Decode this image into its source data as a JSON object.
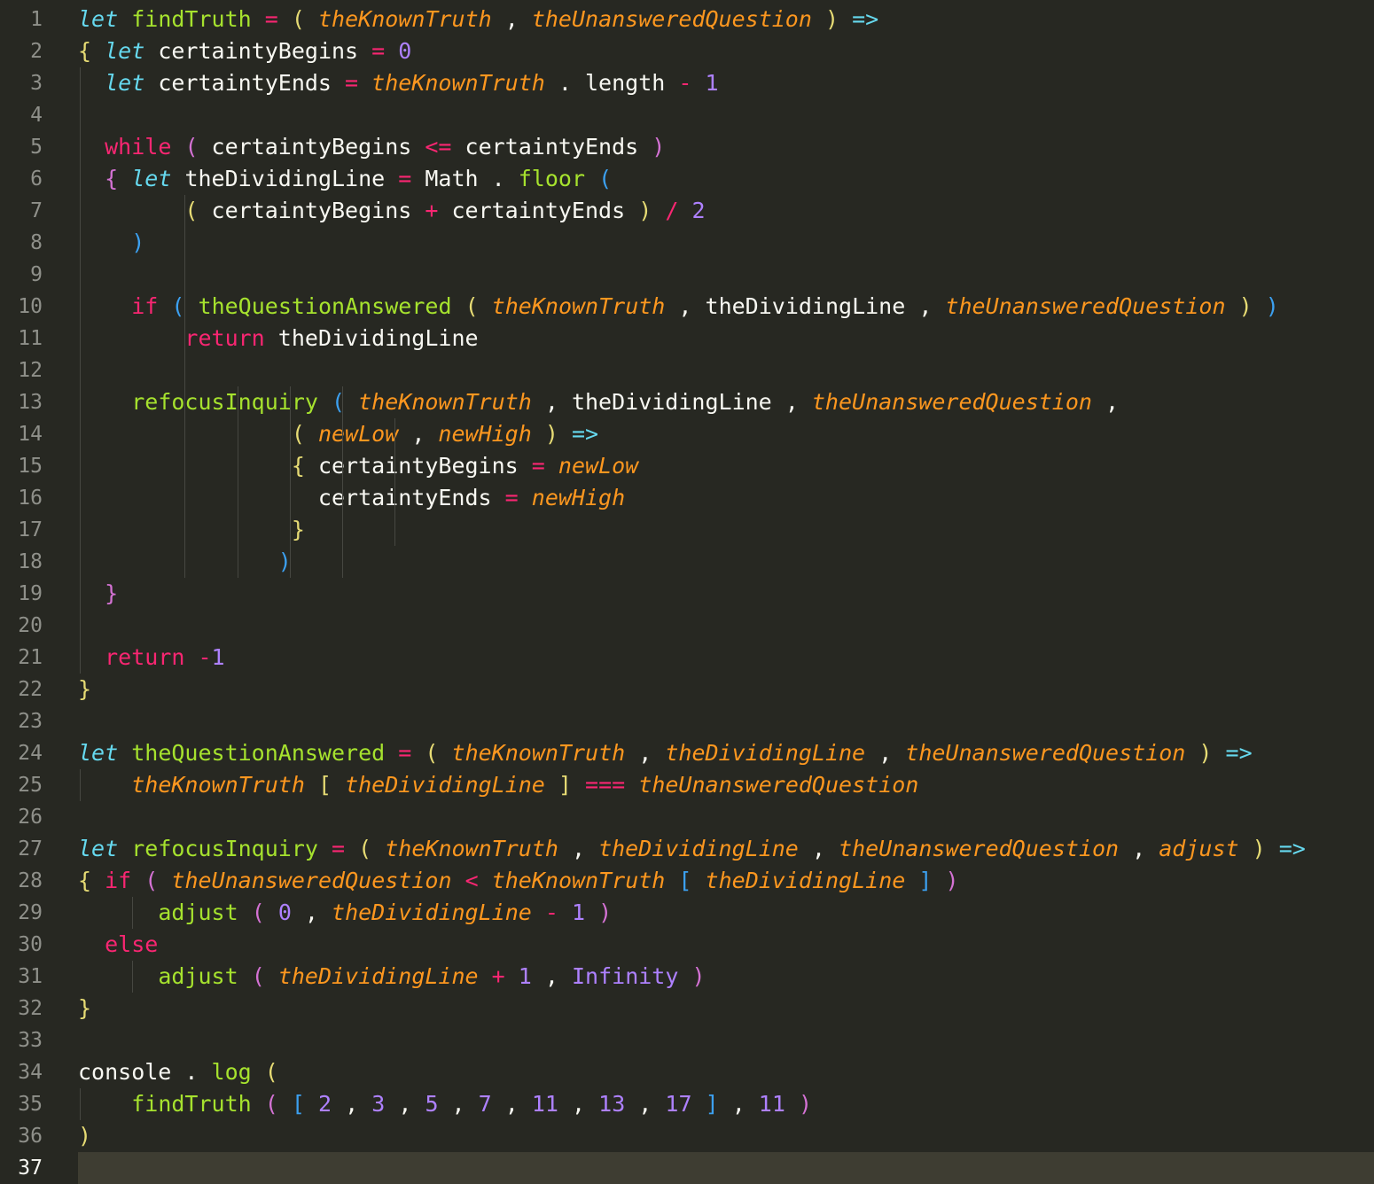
{
  "editor": {
    "theme_colors": {
      "background": "#272822",
      "keyword_let": "#66d9ef",
      "keyword": "#f92672",
      "function": "#a6e22e",
      "parameter": "#fd971f",
      "number": "#ae81ff",
      "bracket_yellow": "#e6db74",
      "bracket_pink": "#d472d4",
      "bracket_blue": "#3ca0f0"
    },
    "active_line": 37,
    "lines": [
      [
        [
          "kw-let",
          "let"
        ],
        [
          "plain",
          " "
        ],
        [
          "fn",
          "findTruth"
        ],
        [
          "plain",
          " "
        ],
        [
          "op",
          "="
        ],
        [
          "plain",
          " "
        ],
        [
          "br-y",
          "("
        ],
        [
          "plain",
          " "
        ],
        [
          "param",
          "theKnownTruth"
        ],
        [
          "plain",
          " , "
        ],
        [
          "param",
          "theUnansweredQuestion"
        ],
        [
          "plain",
          " "
        ],
        [
          "br-y",
          ")"
        ],
        [
          "plain",
          " "
        ],
        [
          "arrow",
          "=>"
        ]
      ],
      [
        [
          "br-y",
          "{"
        ],
        [
          "plain",
          " "
        ],
        [
          "kw-let",
          "let"
        ],
        [
          "plain",
          " certaintyBegins "
        ],
        [
          "op",
          "="
        ],
        [
          "plain",
          " "
        ],
        [
          "num",
          "0"
        ]
      ],
      [
        [
          "plain",
          "  "
        ],
        [
          "kw-let",
          "let"
        ],
        [
          "plain",
          " certaintyEnds "
        ],
        [
          "op",
          "="
        ],
        [
          "plain",
          " "
        ],
        [
          "param",
          "theKnownTruth"
        ],
        [
          "plain",
          " . length "
        ],
        [
          "op",
          "-"
        ],
        [
          "plain",
          " "
        ],
        [
          "num",
          "1"
        ]
      ],
      [],
      [
        [
          "plain",
          "  "
        ],
        [
          "kw",
          "while"
        ],
        [
          "plain",
          " "
        ],
        [
          "br-p",
          "("
        ],
        [
          "plain",
          " certaintyBegins "
        ],
        [
          "op",
          "<="
        ],
        [
          "plain",
          " certaintyEnds "
        ],
        [
          "br-p",
          ")"
        ]
      ],
      [
        [
          "plain",
          "  "
        ],
        [
          "br-p",
          "{"
        ],
        [
          "plain",
          " "
        ],
        [
          "kw-let",
          "let"
        ],
        [
          "plain",
          " theDividingLine "
        ],
        [
          "op",
          "="
        ],
        [
          "plain",
          " Math . "
        ],
        [
          "fn",
          "floor"
        ],
        [
          "plain",
          " "
        ],
        [
          "br-b",
          "("
        ]
      ],
      [
        [
          "plain",
          "        "
        ],
        [
          "br-y",
          "("
        ],
        [
          "plain",
          " certaintyBegins "
        ],
        [
          "op",
          "+"
        ],
        [
          "plain",
          " certaintyEnds "
        ],
        [
          "br-y",
          ")"
        ],
        [
          "plain",
          " "
        ],
        [
          "op",
          "/"
        ],
        [
          "plain",
          " "
        ],
        [
          "num",
          "2"
        ]
      ],
      [
        [
          "plain",
          "    "
        ],
        [
          "br-b",
          ")"
        ]
      ],
      [],
      [
        [
          "plain",
          "    "
        ],
        [
          "kw",
          "if"
        ],
        [
          "plain",
          " "
        ],
        [
          "br-b",
          "("
        ],
        [
          "plain",
          " "
        ],
        [
          "fn",
          "theQuestionAnswered"
        ],
        [
          "plain",
          " "
        ],
        [
          "br-y",
          "("
        ],
        [
          "plain",
          " "
        ],
        [
          "param",
          "theKnownTruth"
        ],
        [
          "plain",
          " , theDividingLine , "
        ],
        [
          "param",
          "theUnansweredQuestion"
        ],
        [
          "plain",
          " "
        ],
        [
          "br-y",
          ")"
        ],
        [
          "plain",
          " "
        ],
        [
          "br-b",
          ")"
        ]
      ],
      [
        [
          "plain",
          "        "
        ],
        [
          "kw",
          "return"
        ],
        [
          "plain",
          " theDividingLine"
        ]
      ],
      [],
      [
        [
          "plain",
          "    "
        ],
        [
          "fn",
          "refocusInquiry"
        ],
        [
          "plain",
          " "
        ],
        [
          "br-b",
          "("
        ],
        [
          "plain",
          " "
        ],
        [
          "param",
          "theKnownTruth"
        ],
        [
          "plain",
          " , theDividingLine , "
        ],
        [
          "param",
          "theUnansweredQuestion"
        ],
        [
          "plain",
          " ,"
        ]
      ],
      [
        [
          "plain",
          "                "
        ],
        [
          "br-y",
          "("
        ],
        [
          "plain",
          " "
        ],
        [
          "param",
          "newLow"
        ],
        [
          "plain",
          " , "
        ],
        [
          "param",
          "newHigh"
        ],
        [
          "plain",
          " "
        ],
        [
          "br-y",
          ")"
        ],
        [
          "plain",
          " "
        ],
        [
          "arrow",
          "=>"
        ]
      ],
      [
        [
          "plain",
          "                "
        ],
        [
          "br-y",
          "{"
        ],
        [
          "plain",
          " certaintyBegins "
        ],
        [
          "op",
          "="
        ],
        [
          "plain",
          " "
        ],
        [
          "param",
          "newLow"
        ]
      ],
      [
        [
          "plain",
          "                  certaintyEnds "
        ],
        [
          "op",
          "="
        ],
        [
          "plain",
          " "
        ],
        [
          "param",
          "newHigh"
        ]
      ],
      [
        [
          "plain",
          "                "
        ],
        [
          "br-y",
          "}"
        ]
      ],
      [
        [
          "plain",
          "               "
        ],
        [
          "br-b",
          ")"
        ]
      ],
      [
        [
          "plain",
          "  "
        ],
        [
          "br-p",
          "}"
        ]
      ],
      [],
      [
        [
          "plain",
          "  "
        ],
        [
          "kw",
          "return"
        ],
        [
          "plain",
          " "
        ],
        [
          "op",
          "-"
        ],
        [
          "num",
          "1"
        ]
      ],
      [
        [
          "br-y",
          "}"
        ]
      ],
      [],
      [
        [
          "kw-let",
          "let"
        ],
        [
          "plain",
          " "
        ],
        [
          "fn",
          "theQuestionAnswered"
        ],
        [
          "plain",
          " "
        ],
        [
          "op",
          "="
        ],
        [
          "plain",
          " "
        ],
        [
          "br-y",
          "("
        ],
        [
          "plain",
          " "
        ],
        [
          "param",
          "theKnownTruth"
        ],
        [
          "plain",
          " , "
        ],
        [
          "param",
          "theDividingLine"
        ],
        [
          "plain",
          " , "
        ],
        [
          "param",
          "theUnansweredQuestion"
        ],
        [
          "plain",
          " "
        ],
        [
          "br-y",
          ")"
        ],
        [
          "plain",
          " "
        ],
        [
          "arrow",
          "=>"
        ]
      ],
      [
        [
          "plain",
          "    "
        ],
        [
          "param",
          "theKnownTruth"
        ],
        [
          "plain",
          " "
        ],
        [
          "br-y",
          "["
        ],
        [
          "plain",
          " "
        ],
        [
          "param",
          "theDividingLine"
        ],
        [
          "plain",
          " "
        ],
        [
          "br-y",
          "]"
        ],
        [
          "plain",
          " "
        ],
        [
          "op",
          "==="
        ],
        [
          "plain",
          " "
        ],
        [
          "param",
          "theUnansweredQuestion"
        ]
      ],
      [],
      [
        [
          "kw-let",
          "let"
        ],
        [
          "plain",
          " "
        ],
        [
          "fn",
          "refocusInquiry"
        ],
        [
          "plain",
          " "
        ],
        [
          "op",
          "="
        ],
        [
          "plain",
          " "
        ],
        [
          "br-y",
          "("
        ],
        [
          "plain",
          " "
        ],
        [
          "param",
          "theKnownTruth"
        ],
        [
          "plain",
          " , "
        ],
        [
          "param",
          "theDividingLine"
        ],
        [
          "plain",
          " , "
        ],
        [
          "param",
          "theUnansweredQuestion"
        ],
        [
          "plain",
          " , "
        ],
        [
          "param",
          "adjust"
        ],
        [
          "plain",
          " "
        ],
        [
          "br-y",
          ")"
        ],
        [
          "plain",
          " "
        ],
        [
          "arrow",
          "=>"
        ]
      ],
      [
        [
          "br-y",
          "{"
        ],
        [
          "plain",
          " "
        ],
        [
          "kw",
          "if"
        ],
        [
          "plain",
          " "
        ],
        [
          "br-p",
          "("
        ],
        [
          "plain",
          " "
        ],
        [
          "param",
          "theUnansweredQuestion"
        ],
        [
          "plain",
          " "
        ],
        [
          "op",
          "<"
        ],
        [
          "plain",
          " "
        ],
        [
          "param",
          "theKnownTruth"
        ],
        [
          "plain",
          " "
        ],
        [
          "br-b",
          "["
        ],
        [
          "plain",
          " "
        ],
        [
          "param",
          "theDividingLine"
        ],
        [
          "plain",
          " "
        ],
        [
          "br-b",
          "]"
        ],
        [
          "plain",
          " "
        ],
        [
          "br-p",
          ")"
        ]
      ],
      [
        [
          "plain",
          "      "
        ],
        [
          "fn",
          "adjust"
        ],
        [
          "plain",
          " "
        ],
        [
          "br-p",
          "("
        ],
        [
          "plain",
          " "
        ],
        [
          "num",
          "0"
        ],
        [
          "plain",
          " , "
        ],
        [
          "param",
          "theDividingLine"
        ],
        [
          "plain",
          " "
        ],
        [
          "op",
          "-"
        ],
        [
          "plain",
          " "
        ],
        [
          "num",
          "1"
        ],
        [
          "plain",
          " "
        ],
        [
          "br-p",
          ")"
        ]
      ],
      [
        [
          "plain",
          "  "
        ],
        [
          "kw",
          "else"
        ]
      ],
      [
        [
          "plain",
          "      "
        ],
        [
          "fn",
          "adjust"
        ],
        [
          "plain",
          " "
        ],
        [
          "br-p",
          "("
        ],
        [
          "plain",
          " "
        ],
        [
          "param",
          "theDividingLine"
        ],
        [
          "plain",
          " "
        ],
        [
          "op",
          "+"
        ],
        [
          "plain",
          " "
        ],
        [
          "num",
          "1"
        ],
        [
          "plain",
          " , "
        ],
        [
          "const",
          "Infinity"
        ],
        [
          "plain",
          " "
        ],
        [
          "br-p",
          ")"
        ]
      ],
      [
        [
          "br-y",
          "}"
        ]
      ],
      [],
      [
        [
          "plain",
          "console . "
        ],
        [
          "fn",
          "log"
        ],
        [
          "plain",
          " "
        ],
        [
          "br-y",
          "("
        ]
      ],
      [
        [
          "plain",
          "    "
        ],
        [
          "fn",
          "findTruth"
        ],
        [
          "plain",
          " "
        ],
        [
          "br-p",
          "("
        ],
        [
          "plain",
          " "
        ],
        [
          "br-b",
          "["
        ],
        [
          "plain",
          " "
        ],
        [
          "num",
          "2"
        ],
        [
          "plain",
          " , "
        ],
        [
          "num",
          "3"
        ],
        [
          "plain",
          " , "
        ],
        [
          "num",
          "5"
        ],
        [
          "plain",
          " , "
        ],
        [
          "num",
          "7"
        ],
        [
          "plain",
          " , "
        ],
        [
          "num",
          "11"
        ],
        [
          "plain",
          " , "
        ],
        [
          "num",
          "13"
        ],
        [
          "plain",
          " , "
        ],
        [
          "num",
          "17"
        ],
        [
          "plain",
          " "
        ],
        [
          "br-b",
          "]"
        ],
        [
          "plain",
          " , "
        ],
        [
          "num",
          "11"
        ],
        [
          "plain",
          " "
        ],
        [
          "br-p",
          ")"
        ]
      ],
      [
        [
          "br-y",
          ")"
        ]
      ],
      []
    ]
  }
}
